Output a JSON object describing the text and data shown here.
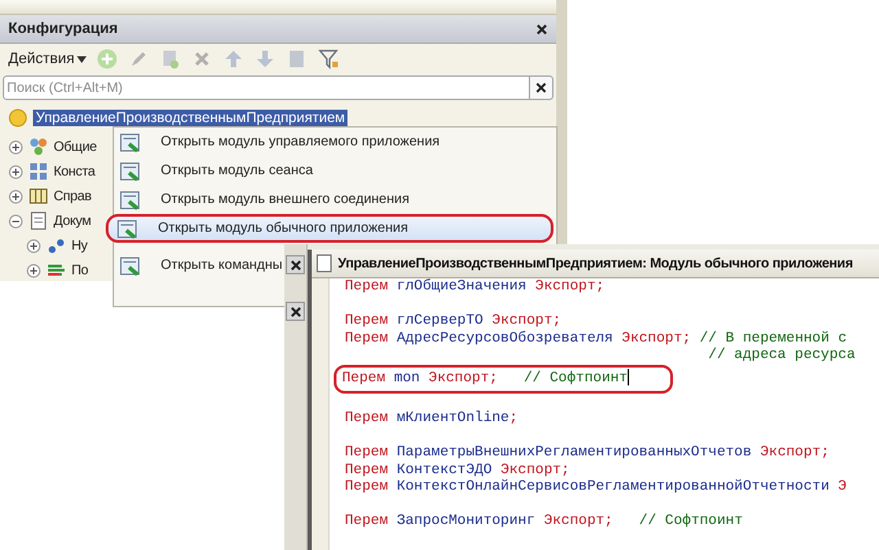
{
  "config_panel": {
    "title": "Конфигурация",
    "actions_menu": "Действия",
    "search": {
      "placeholder": "Поиск (Ctrl+Alt+M)"
    },
    "tree": [
      {
        "label": "УправлениеПроизводственнымПредприятием",
        "kind": "root",
        "selected": true,
        "children": [
          {
            "label": "Общие",
            "kind": "common",
            "selected": false,
            "expanded": false
          },
          {
            "label": "Конста",
            "kind": "constants",
            "selected": false,
            "expanded": false
          },
          {
            "label": "Справ",
            "kind": "catalogs",
            "selected": false,
            "expanded": false
          },
          {
            "label": "Докум",
            "kind": "documents",
            "selected": false,
            "expanded": true,
            "children": [
              {
                "label": "Ну",
                "kind": "numbering",
                "selected": false,
                "expanded": false
              },
              {
                "label": "По",
                "kind": "sequences",
                "selected": false,
                "expanded": false
              }
            ]
          }
        ]
      }
    ]
  },
  "context_menu": {
    "items": [
      {
        "label": "Открыть модуль управляемого приложения",
        "selected": false,
        "circled": false
      },
      {
        "label": "Открыть модуль сеанса",
        "selected": false,
        "circled": false
      },
      {
        "label": "Открыть модуль внешнего соединения",
        "selected": false,
        "circled": false
      },
      {
        "label": "Открыть модуль обычного приложения",
        "selected": true,
        "circled": true
      },
      {
        "label": "Открыть командны",
        "selected": false,
        "circled": false
      }
    ]
  },
  "module_window": {
    "title": "УправлениеПроизводственнымПредприятием: Модуль обычного приложения",
    "lines": [
      {
        "kind": "code",
        "circled": false,
        "segments": [
          {
            "kind": "keyword",
            "text": "Перем"
          },
          {
            "kind": "ident",
            "text": " глОбщиеЗначения "
          },
          {
            "kind": "keyword",
            "text": "Экспорт;"
          }
        ]
      },
      {
        "kind": "blank"
      },
      {
        "kind": "code",
        "circled": false,
        "segments": [
          {
            "kind": "keyword",
            "text": "Перем"
          },
          {
            "kind": "ident",
            "text": " глСерверТО "
          },
          {
            "kind": "keyword",
            "text": "Экспорт;"
          }
        ]
      },
      {
        "kind": "code",
        "circled": false,
        "segments": [
          {
            "kind": "keyword",
            "text": "Перем"
          },
          {
            "kind": "ident",
            "text": " АдресРесурсовОбозревателя "
          },
          {
            "kind": "keyword",
            "text": "Экспорт;"
          },
          {
            "kind": "comment",
            "text": " // В переменной с"
          }
        ]
      },
      {
        "kind": "code",
        "circled": false,
        "segments": [
          {
            "kind": "comment",
            "text": "                                          // адреса ресурса"
          }
        ]
      },
      {
        "kind": "code",
        "circled": true,
        "cursor": true,
        "segments": [
          {
            "kind": "keyword",
            "text": "Перем"
          },
          {
            "kind": "ident",
            "text": " mon "
          },
          {
            "kind": "keyword",
            "text": "Экспорт;"
          },
          {
            "kind": "comment",
            "text": "   // Софтпоинт"
          }
        ]
      },
      {
        "kind": "blank"
      },
      {
        "kind": "code",
        "circled": false,
        "segments": [
          {
            "kind": "keyword",
            "text": "Перем"
          },
          {
            "kind": "ident",
            "text": " мКлиентOnline"
          },
          {
            "kind": "keyword",
            "text": ";"
          }
        ]
      },
      {
        "kind": "blank"
      },
      {
        "kind": "code",
        "circled": false,
        "segments": [
          {
            "kind": "keyword",
            "text": "Перем"
          },
          {
            "kind": "ident",
            "text": " ПараметрыВнешнихРегламентированныхОтчетов "
          },
          {
            "kind": "keyword",
            "text": "Экспорт;"
          }
        ]
      },
      {
        "kind": "code",
        "circled": false,
        "segments": [
          {
            "kind": "keyword",
            "text": "Перем"
          },
          {
            "kind": "ident",
            "text": " КонтекстЭДО "
          },
          {
            "kind": "keyword",
            "text": "Экспорт;"
          }
        ]
      },
      {
        "kind": "code",
        "circled": false,
        "segments": [
          {
            "kind": "keyword",
            "text": "Перем"
          },
          {
            "kind": "ident",
            "text": " КонтекстОнлайнСервисовРегламентированнойОтчетности "
          },
          {
            "kind": "keyword",
            "text": "Э"
          }
        ]
      },
      {
        "kind": "blank"
      },
      {
        "kind": "code",
        "circled": false,
        "segments": [
          {
            "kind": "keyword",
            "text": "Перем"
          },
          {
            "kind": "ident",
            "text": " ЗапросМониторинг "
          },
          {
            "kind": "keyword",
            "text": "Экспорт;"
          },
          {
            "kind": "comment",
            "text": "   // Софтпоинт"
          }
        ]
      }
    ]
  }
}
